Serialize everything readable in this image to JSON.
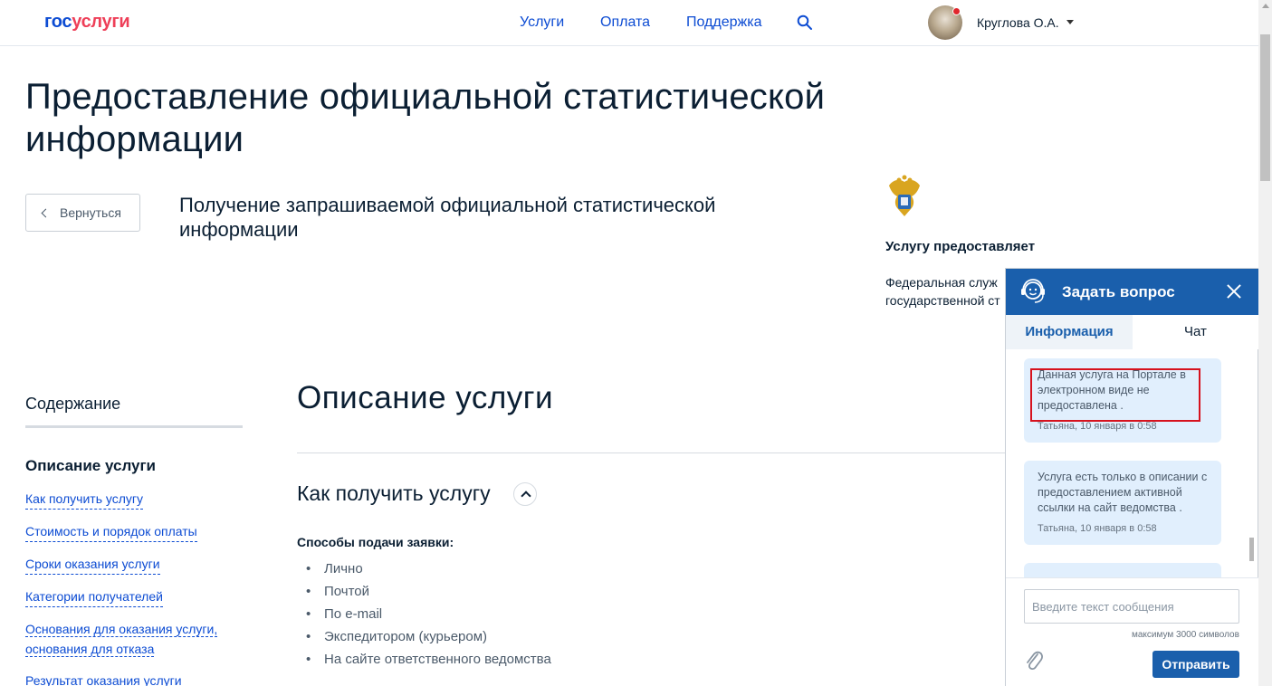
{
  "header": {
    "logo_part1": "гос",
    "logo_part2": "услуги",
    "nav": [
      "Услуги",
      "Оплата",
      "Поддержка"
    ],
    "user_name": "Круглова О.А.",
    "icons": [
      "search-icon",
      "avatar",
      "notification-dot",
      "chevron-down-icon"
    ]
  },
  "page": {
    "title": "Предоставление официальной статистической информации",
    "back_label": "Вернуться",
    "subtitle": "Получение запрашиваемой официальной статистической информации"
  },
  "provider": {
    "label": "Услугу предоставляет",
    "name_line1": "Федеральная служ",
    "name_line2": "государственной ст"
  },
  "toc": {
    "title": "Содержание",
    "active": "Описание услуги",
    "links": [
      "Как получить услугу",
      "Стоимость и порядок оплаты",
      "Сроки оказания услуги",
      "Категории получателей",
      "Основания для оказания услуги, основания для отказа",
      "Результат оказания услуги"
    ]
  },
  "main": {
    "section_title": "Описание услуги",
    "how_title": "Как получить услугу",
    "methods_label": "Способы подачи заявки:",
    "methods": [
      "Лично",
      "Почтой",
      "По e-mail",
      "Экспедитором (курьером)",
      "На сайте ответственного ведомства"
    ]
  },
  "chat": {
    "title": "Задать вопрос",
    "tab_info": "Информация",
    "tab_chat": "Чат",
    "messages": [
      {
        "text": "Данная услуга на Портале в электронном виде не предоставлена .",
        "meta": "Татьяна, 10 января в 0:58"
      },
      {
        "text": "Услуга есть только в описании с предоставлением активной ссылки на сайт ведомства .",
        "meta": "Татьяна, 10 января в 0:58"
      }
    ],
    "input_placeholder": "Введите текст сообщения",
    "limit_text": "максимум 3000 символов",
    "send_label": "Отправить"
  },
  "colors": {
    "brand_blue": "#0d4cd3",
    "brand_red": "#ee3f58",
    "chat_blue": "#1a5fac",
    "highlight_red": "#d6121e"
  }
}
